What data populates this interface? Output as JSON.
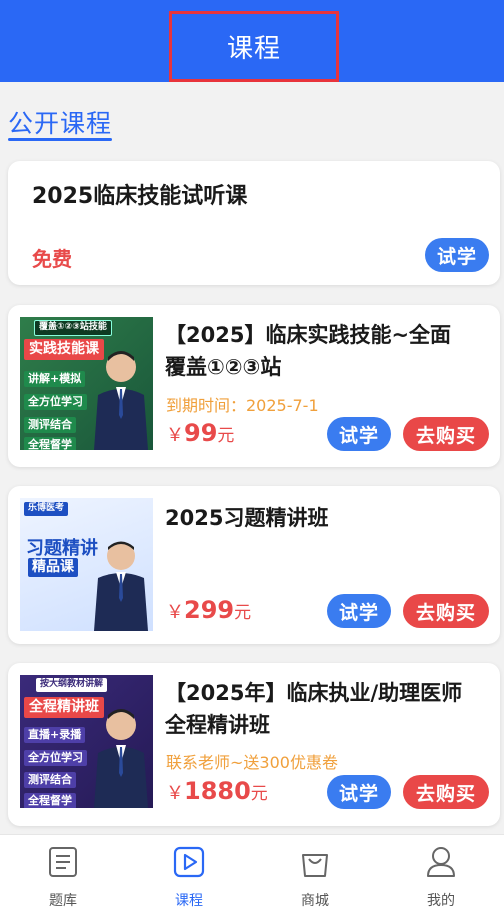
{
  "header": {
    "title": "课程"
  },
  "section": {
    "title": "公开课程"
  },
  "free_course": {
    "title": "2025临床技能试听课",
    "price": "免费",
    "try_label": "试学"
  },
  "courses": [
    {
      "title_line1": "【2025】临床实践技能~全面",
      "title_line2": "覆盖①②③站",
      "subtitle": "到期时间：2025-7-1",
      "price_symbol": "￥",
      "price": "99",
      "price_unit": "元",
      "try_label": "试学",
      "buy_label": "去购买",
      "thumb": {
        "badge": "覆盖①②③站技能",
        "headline": "实践技能课",
        "tags": [
          "讲解+模拟",
          "全方位学习",
          "测评结合",
          "全程督学"
        ]
      }
    },
    {
      "title_line1": "2025习题精讲班",
      "title_line2": "",
      "subtitle": "",
      "price_symbol": "￥",
      "price": "299",
      "price_unit": "元",
      "try_label": "试学",
      "buy_label": "去购买",
      "thumb": {
        "badge": "乐博医考",
        "headline": "习题精讲",
        "headline2": "精品课"
      }
    },
    {
      "title_line1": "【2025年】临床执业/助理医师",
      "title_line2": "全程精讲班",
      "subtitle": "联系老师~送300优惠卷",
      "price_symbol": "￥",
      "price": "1880",
      "price_unit": "元",
      "try_label": "试学",
      "buy_label": "去购买",
      "thumb": {
        "badge": "按大纲教材讲解",
        "headline": "全程精讲班",
        "tags": [
          "直播+录播",
          "全方位学习",
          "测评结合",
          "全程督学"
        ]
      }
    }
  ],
  "tabbar": {
    "items": [
      {
        "label": "题库",
        "icon": "question-bank-icon"
      },
      {
        "label": "课程",
        "icon": "play-course-icon"
      },
      {
        "label": "商城",
        "icon": "shopping-bag-icon"
      },
      {
        "label": "我的",
        "icon": "person-icon"
      }
    ],
    "active_index": 1
  },
  "colors": {
    "primary": "#2a68f5",
    "price": "#e84a4a",
    "try_button": "#3a7cf0",
    "buy_button": "#e94848",
    "subtitle": "#f0a03c"
  }
}
